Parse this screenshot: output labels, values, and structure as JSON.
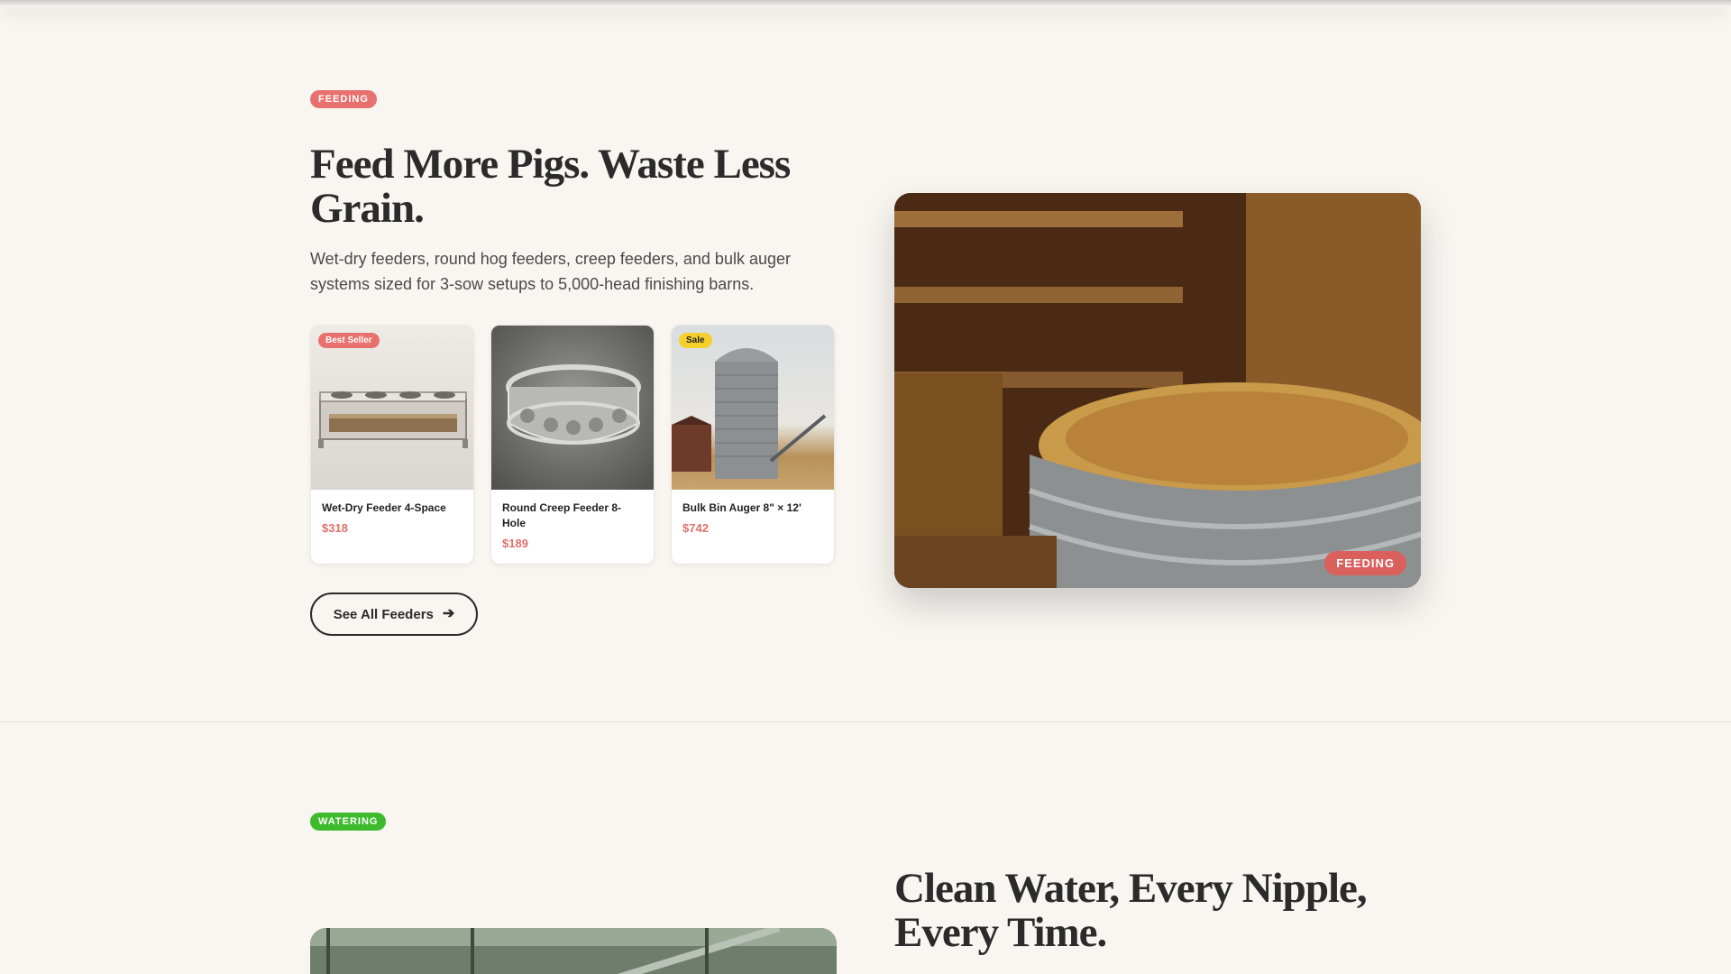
{
  "feeding": {
    "tag": "FEEDING",
    "title": "Feed More Pigs. Waste Less Grain.",
    "description": "Wet-dry feeders, round hog feeders, creep feeders, and bulk auger systems sized for 3-sow setups to 5,000-head finishing barns.",
    "products": [
      {
        "badge": "Best Seller",
        "name": "Wet-Dry Feeder 4-Space",
        "price": "$318"
      },
      {
        "badge": "",
        "name": "Round Creep Feeder 8-Hole",
        "price": "$189"
      },
      {
        "badge": "Sale",
        "name": "Bulk Bin Auger 8\" × 12'",
        "price": "$742"
      }
    ],
    "cta_label": "See All Feeders",
    "hero_badge": "FEEDING"
  },
  "watering": {
    "tag": "WATERING",
    "title": "Clean Water, Every Nipple, Every Time."
  },
  "colors": {
    "background": "#f9f6f2",
    "feeding_accent": "#e8706e",
    "watering_accent": "#3dbb2c",
    "sale_badge": "#f5d02b"
  },
  "icons": {
    "cta_arrow": "arrow-right-icon"
  }
}
